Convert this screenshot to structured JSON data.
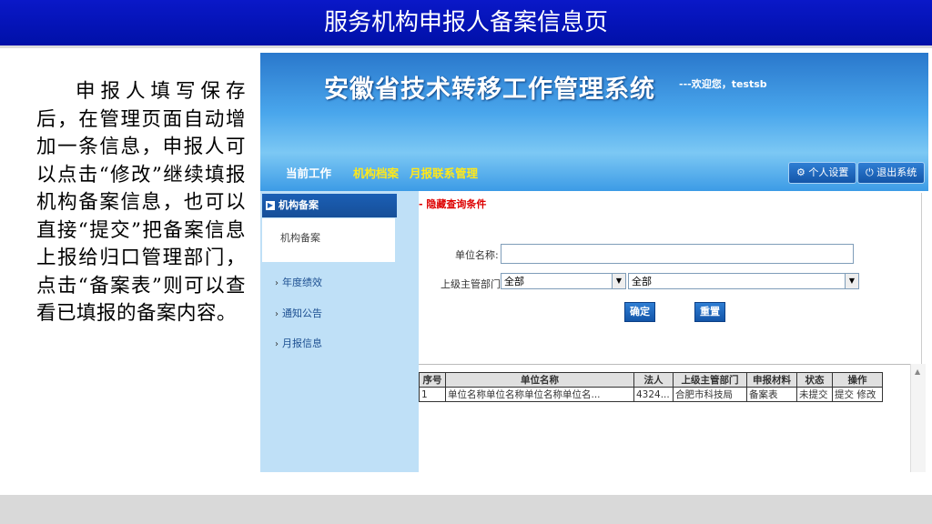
{
  "slide": {
    "title": "服务机构申报人备案信息页",
    "description": "申报人填写保存后，在管理页面自动增加一条信息，申报人可以点击“修改”继续填报机构备案信息，也可以直接“提交”把备案信息上报给归口管理部门，点击“备案表”则可以查看已填报的备案内容。"
  },
  "app": {
    "system_title": "安徽省技术转移工作管理系统",
    "welcome": "---欢迎您，testsb",
    "menu": [
      "当前工作",
      "机构档案",
      "月报联系管理"
    ],
    "top_buttons": {
      "user_settings": "个人设置",
      "logout": "退出系统"
    },
    "sidebar": {
      "header": "机构备案",
      "sub_item": "机构备案",
      "items": [
        "年度绩效",
        "通知公告",
        "月报信息"
      ]
    },
    "search": {
      "title": "- 隐藏查询条件",
      "name_label": "单位名称:",
      "name_value": "",
      "dept_label": "上级主管部门:",
      "dept_select_1": "全部",
      "dept_select_2": "全部",
      "confirm": "确定",
      "reset": "重置"
    },
    "table": {
      "headers": [
        "序号",
        "单位名称",
        "法人",
        "上级主管部门",
        "申报材料",
        "状态",
        "操作"
      ],
      "rows": [
        {
          "no": "1",
          "name": "单位名称单位名称单位名称单位名...",
          "legal": "4324...",
          "dept": "合肥市科技局",
          "material": "备案表",
          "status": "未提交",
          "ops": "提交 修改"
        }
      ]
    }
  }
}
